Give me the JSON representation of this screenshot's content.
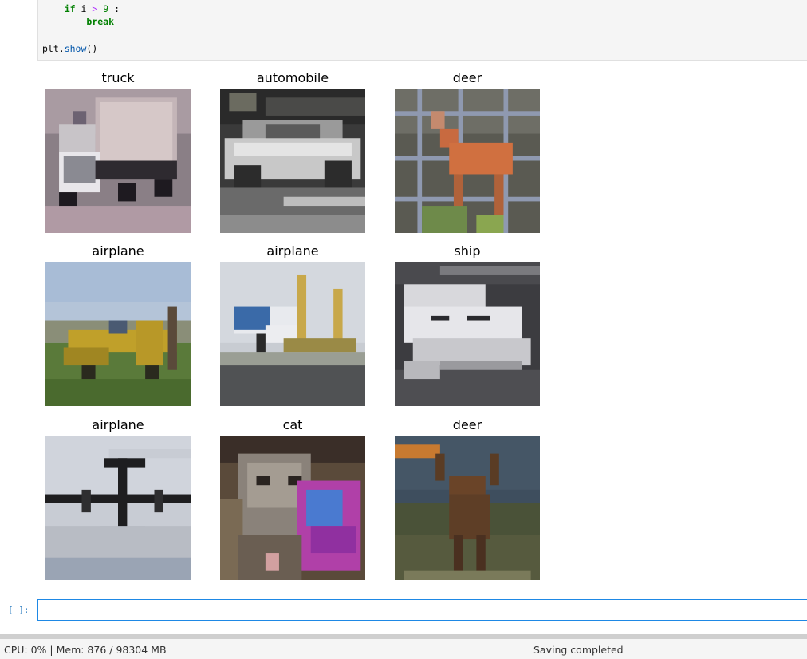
{
  "code": {
    "line1": {
      "kw": "if",
      "var": "i",
      "op": ">",
      "num": "9",
      "colon": ":"
    },
    "line2": {
      "kw": "break"
    },
    "line3": {
      "obj": "plt.",
      "fn": "show",
      "parens": "()"
    }
  },
  "figure": {
    "tiles": [
      {
        "label": "truck"
      },
      {
        "label": "automobile"
      },
      {
        "label": "deer"
      },
      {
        "label": "airplane"
      },
      {
        "label": "airplane"
      },
      {
        "label": "ship"
      },
      {
        "label": "airplane"
      },
      {
        "label": "cat"
      },
      {
        "label": "deer"
      }
    ]
  },
  "input_cell": {
    "prompt": "[ ]:"
  },
  "status": {
    "left": "CPU: 0% | Mem: 876 / 98304 MB",
    "right": "Saving completed"
  }
}
